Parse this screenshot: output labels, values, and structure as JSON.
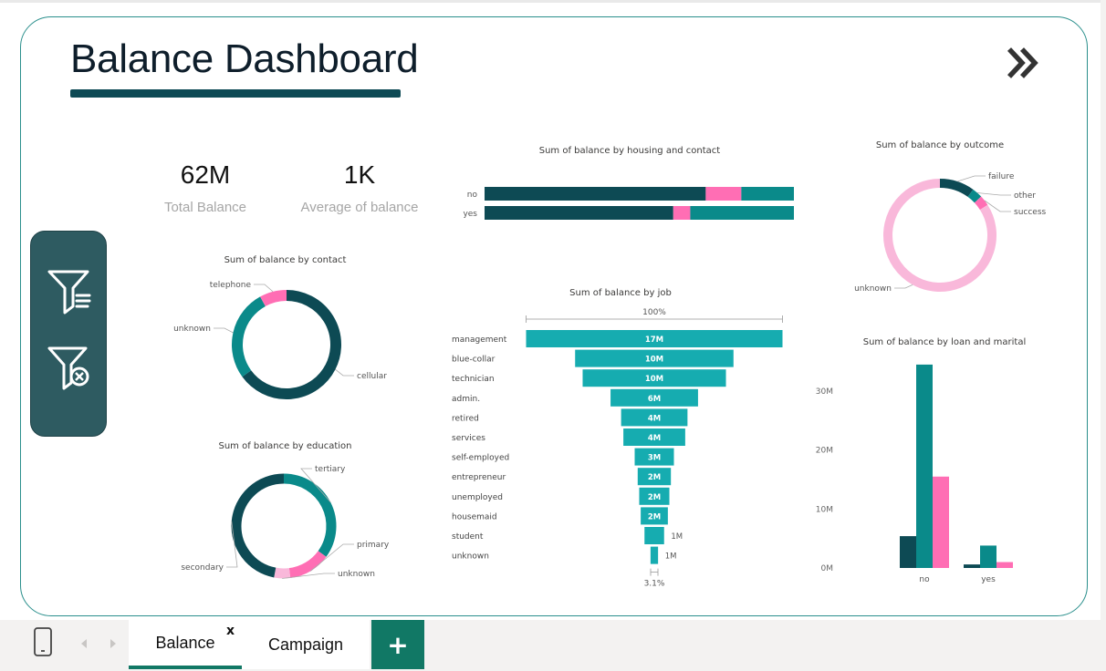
{
  "page": {
    "title": "Balance Dashboard",
    "colors": {
      "dark": "#0d4a54",
      "teal": "#0a8a8a",
      "pink": "#ff6eb4",
      "light_pink": "#f9b8da",
      "funnel": "#16acb0"
    }
  },
  "kpis": [
    {
      "value": "62M",
      "label": "Total Balance"
    },
    {
      "value": "1K",
      "label": "Average of balance"
    }
  ],
  "filter_panel": {
    "icons": [
      "filter-lines-icon",
      "filter-clear-icon"
    ]
  },
  "nav": {
    "icon": "double-chevron-right-icon"
  },
  "tabs": {
    "items": [
      {
        "label": "Balance",
        "active": true
      },
      {
        "label": "Campaign",
        "active": false
      }
    ],
    "close": "x",
    "add": "+"
  },
  "chart_data": [
    {
      "type": "bar",
      "orientation": "horizontal-stacked-100",
      "title": "Sum of balance by housing and contact",
      "categories": [
        "no",
        "yes"
      ],
      "series": [
        {
          "color": "#0d4a54",
          "values": [
            71.5,
            61
          ]
        },
        {
          "color": "#ff6eb4",
          "values": [
            11.5,
            5.5
          ]
        },
        {
          "color": "#0a8a8a",
          "values": [
            17,
            33.5
          ]
        }
      ],
      "units": "percent"
    },
    {
      "type": "pie",
      "variant": "donut",
      "title": "Sum of balance by outcome",
      "slices": [
        {
          "label": "failure",
          "value": 10,
          "color": "#0d4a54"
        },
        {
          "label": "other",
          "value": 3,
          "color": "#0a8a8a"
        },
        {
          "label": "success",
          "value": 3,
          "color": "#ff6eb4"
        },
        {
          "label": "unknown",
          "value": 84,
          "color": "#f9b8da"
        }
      ]
    },
    {
      "type": "pie",
      "variant": "donut",
      "title": "Sum of balance by contact",
      "slices": [
        {
          "label": "cellular",
          "value": 65,
          "color": "#0d4a54"
        },
        {
          "label": "unknown",
          "value": 27,
          "color": "#0a8a8a"
        },
        {
          "label": "telephone",
          "value": 8,
          "color": "#ff6eb4"
        }
      ]
    },
    {
      "type": "pie",
      "variant": "donut",
      "title": "Sum of balance by education",
      "slices": [
        {
          "label": "tertiary",
          "value": 35,
          "color": "#0a8a8a"
        },
        {
          "label": "primary",
          "value": 13,
          "color": "#ff6eb4"
        },
        {
          "label": "unknown",
          "value": 5,
          "color": "#f9b8da"
        },
        {
          "label": "secondary",
          "value": 47,
          "color": "#0d4a54"
        }
      ]
    },
    {
      "type": "bar",
      "variant": "funnel",
      "title": "Sum of balance by job",
      "top_label": "100%",
      "bottom_label": "3.1%",
      "categories": [
        "management",
        "blue-collar",
        "technician",
        "admin.",
        "retired",
        "services",
        "self-employed",
        "entrepreneur",
        "unemployed",
        "housemaid",
        "student",
        "unknown"
      ],
      "values": [
        17,
        10.5,
        9.5,
        5.8,
        4.4,
        4.1,
        2.6,
        2.2,
        2.0,
        1.8,
        1.3,
        0.5
      ],
      "labels": [
        "17M",
        "10M",
        "10M",
        "6M",
        "4M",
        "4M",
        "3M",
        "2M",
        "2M",
        "2M",
        "1M",
        "1M"
      ],
      "units": "M"
    },
    {
      "type": "bar",
      "variant": "clustered-column",
      "title": "Sum of balance by loan and marital",
      "categories": [
        "no",
        "yes"
      ],
      "series": [
        {
          "color": "#0d4a54",
          "values": [
            5.4,
            0.6
          ]
        },
        {
          "color": "#0a8a8a",
          "values": [
            34.5,
            3.8
          ]
        },
        {
          "color": "#ff6eb4",
          "values": [
            15.5,
            1.0
          ]
        }
      ],
      "y_ticks": [
        "0M",
        "10M",
        "20M",
        "30M"
      ],
      "ylim": [
        0,
        34.5
      ],
      "units": "M"
    }
  ]
}
